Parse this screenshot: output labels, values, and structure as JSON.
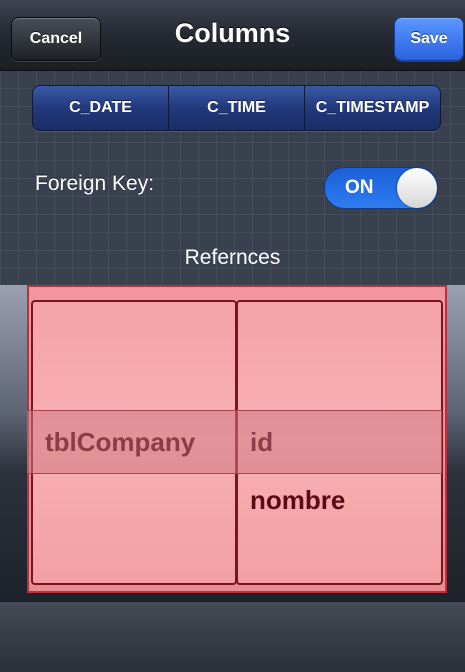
{
  "nav": {
    "title": "Columns",
    "cancel_label": "Cancel",
    "save_label": "Save"
  },
  "segment": {
    "items": [
      "C_DATE",
      "C_TIME",
      "C_TIMESTAMP"
    ]
  },
  "foreign_key": {
    "label": "Foreign Key:",
    "toggle_text": "ON",
    "value": true
  },
  "references": {
    "label": "Refernces",
    "table_column": [
      "tblCompany"
    ],
    "field_column": [
      "id",
      "nombre"
    ],
    "selected_table": "tblCompany",
    "selected_field": "id"
  },
  "colors": {
    "accent": "#2a62e0",
    "picker_pink": "#f6b1b3",
    "picker_border": "#7a1520"
  }
}
